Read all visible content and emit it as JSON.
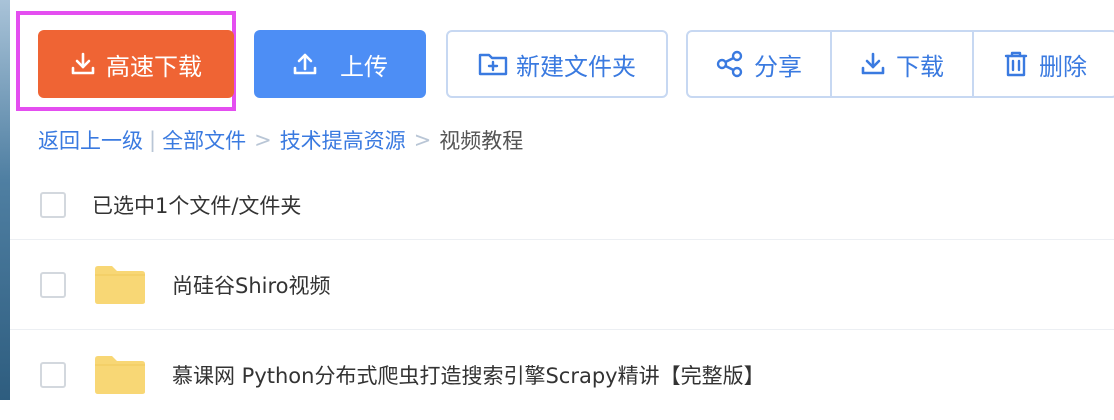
{
  "toolbar": {
    "fast_download_label": "高速下载",
    "upload_label": "上传",
    "new_folder_label": "新建文件夹",
    "share_label": "分享",
    "download_label": "下载",
    "delete_label": "删除"
  },
  "breadcrumb": {
    "back_label": "返回上一级",
    "separator_pipe": "|",
    "items": [
      "全部文件",
      "技术提高资源",
      "视频教程"
    ],
    "separator_arrow": ">"
  },
  "selection": {
    "text": "已选中1个文件/文件夹"
  },
  "files": [
    {
      "name": "尚硅谷Shiro视频",
      "type": "folder"
    },
    {
      "name": "慕课网 Python分布式爬虫打造搜索引擎Scrapy精讲【完整版】",
      "type": "folder"
    }
  ],
  "colors": {
    "fast_download_bg": "#ef6434",
    "upload_bg": "#4d8ef5",
    "link_blue": "#3a7ae0",
    "highlight_border": "#e44ef0",
    "folder_yellow": "#f8d775"
  },
  "icons": {
    "fast_download": "download-icon",
    "upload": "upload-icon",
    "new_folder": "folder-plus-icon",
    "share": "share-icon",
    "download": "download-icon",
    "delete": "trash-icon",
    "file": "folder-icon"
  }
}
